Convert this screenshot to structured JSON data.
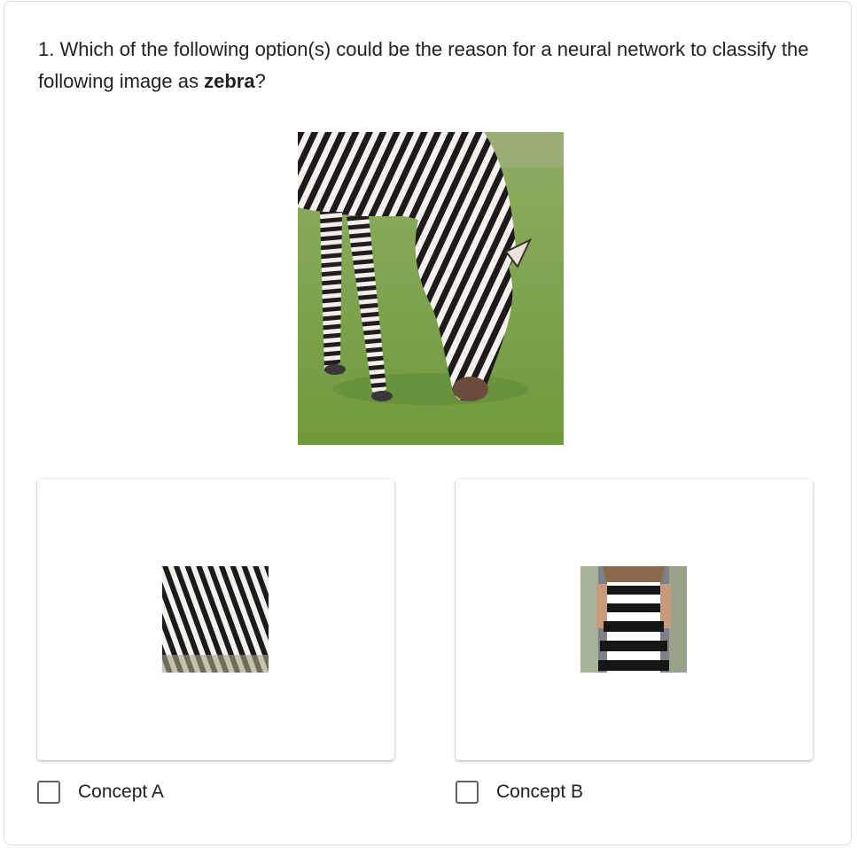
{
  "question": {
    "prefix": "1. Which of the following option(s) could be the reason for a neural network to classify the following image as ",
    "emphasis": "zebra",
    "suffix": "?"
  },
  "main_image": {
    "depicts": "zebra-grazing-on-grass"
  },
  "options": [
    {
      "label": "Concept A",
      "image_depicts": "zebra-stripes-closeup",
      "checked": false
    },
    {
      "label": "Concept B",
      "image_depicts": "black-white-striped-dress",
      "checked": false
    }
  ],
  "colors": {
    "text": "#202124",
    "border": "#dadce0",
    "checkbox": "#5f6368",
    "grass": "#7aa24a"
  }
}
